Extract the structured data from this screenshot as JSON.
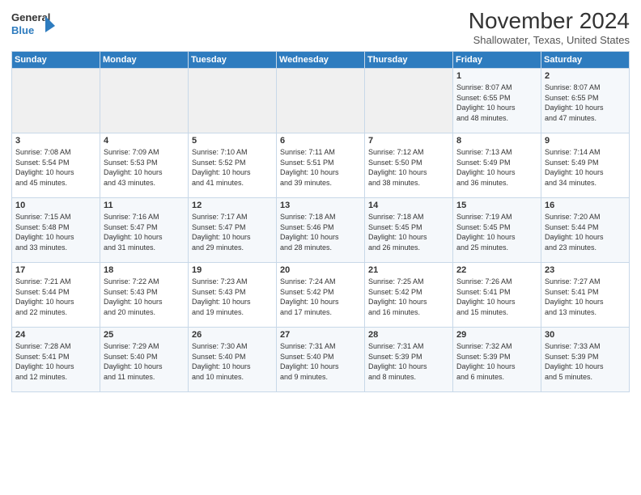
{
  "header": {
    "logo_line1": "General",
    "logo_line2": "Blue",
    "month": "November 2024",
    "location": "Shallowater, Texas, United States"
  },
  "weekdays": [
    "Sunday",
    "Monday",
    "Tuesday",
    "Wednesday",
    "Thursday",
    "Friday",
    "Saturday"
  ],
  "weeks": [
    [
      {
        "day": "",
        "info": ""
      },
      {
        "day": "",
        "info": ""
      },
      {
        "day": "",
        "info": ""
      },
      {
        "day": "",
        "info": ""
      },
      {
        "day": "",
        "info": ""
      },
      {
        "day": "1",
        "info": "Sunrise: 8:07 AM\nSunset: 6:55 PM\nDaylight: 10 hours\nand 48 minutes."
      },
      {
        "day": "2",
        "info": "Sunrise: 8:07 AM\nSunset: 6:55 PM\nDaylight: 10 hours\nand 47 minutes."
      }
    ],
    [
      {
        "day": "3",
        "info": "Sunrise: 7:08 AM\nSunset: 5:54 PM\nDaylight: 10 hours\nand 45 minutes."
      },
      {
        "day": "4",
        "info": "Sunrise: 7:09 AM\nSunset: 5:53 PM\nDaylight: 10 hours\nand 43 minutes."
      },
      {
        "day": "5",
        "info": "Sunrise: 7:10 AM\nSunset: 5:52 PM\nDaylight: 10 hours\nand 41 minutes."
      },
      {
        "day": "6",
        "info": "Sunrise: 7:11 AM\nSunset: 5:51 PM\nDaylight: 10 hours\nand 39 minutes."
      },
      {
        "day": "7",
        "info": "Sunrise: 7:12 AM\nSunset: 5:50 PM\nDaylight: 10 hours\nand 38 minutes."
      },
      {
        "day": "8",
        "info": "Sunrise: 7:13 AM\nSunset: 5:49 PM\nDaylight: 10 hours\nand 36 minutes."
      },
      {
        "day": "9",
        "info": "Sunrise: 7:14 AM\nSunset: 5:49 PM\nDaylight: 10 hours\nand 34 minutes."
      }
    ],
    [
      {
        "day": "10",
        "info": "Sunrise: 7:15 AM\nSunset: 5:48 PM\nDaylight: 10 hours\nand 33 minutes."
      },
      {
        "day": "11",
        "info": "Sunrise: 7:16 AM\nSunset: 5:47 PM\nDaylight: 10 hours\nand 31 minutes."
      },
      {
        "day": "12",
        "info": "Sunrise: 7:17 AM\nSunset: 5:47 PM\nDaylight: 10 hours\nand 29 minutes."
      },
      {
        "day": "13",
        "info": "Sunrise: 7:18 AM\nSunset: 5:46 PM\nDaylight: 10 hours\nand 28 minutes."
      },
      {
        "day": "14",
        "info": "Sunrise: 7:18 AM\nSunset: 5:45 PM\nDaylight: 10 hours\nand 26 minutes."
      },
      {
        "day": "15",
        "info": "Sunrise: 7:19 AM\nSunset: 5:45 PM\nDaylight: 10 hours\nand 25 minutes."
      },
      {
        "day": "16",
        "info": "Sunrise: 7:20 AM\nSunset: 5:44 PM\nDaylight: 10 hours\nand 23 minutes."
      }
    ],
    [
      {
        "day": "17",
        "info": "Sunrise: 7:21 AM\nSunset: 5:44 PM\nDaylight: 10 hours\nand 22 minutes."
      },
      {
        "day": "18",
        "info": "Sunrise: 7:22 AM\nSunset: 5:43 PM\nDaylight: 10 hours\nand 20 minutes."
      },
      {
        "day": "19",
        "info": "Sunrise: 7:23 AM\nSunset: 5:43 PM\nDaylight: 10 hours\nand 19 minutes."
      },
      {
        "day": "20",
        "info": "Sunrise: 7:24 AM\nSunset: 5:42 PM\nDaylight: 10 hours\nand 17 minutes."
      },
      {
        "day": "21",
        "info": "Sunrise: 7:25 AM\nSunset: 5:42 PM\nDaylight: 10 hours\nand 16 minutes."
      },
      {
        "day": "22",
        "info": "Sunrise: 7:26 AM\nSunset: 5:41 PM\nDaylight: 10 hours\nand 15 minutes."
      },
      {
        "day": "23",
        "info": "Sunrise: 7:27 AM\nSunset: 5:41 PM\nDaylight: 10 hours\nand 13 minutes."
      }
    ],
    [
      {
        "day": "24",
        "info": "Sunrise: 7:28 AM\nSunset: 5:41 PM\nDaylight: 10 hours\nand 12 minutes."
      },
      {
        "day": "25",
        "info": "Sunrise: 7:29 AM\nSunset: 5:40 PM\nDaylight: 10 hours\nand 11 minutes."
      },
      {
        "day": "26",
        "info": "Sunrise: 7:30 AM\nSunset: 5:40 PM\nDaylight: 10 hours\nand 10 minutes."
      },
      {
        "day": "27",
        "info": "Sunrise: 7:31 AM\nSunset: 5:40 PM\nDaylight: 10 hours\nand 9 minutes."
      },
      {
        "day": "28",
        "info": "Sunrise: 7:31 AM\nSunset: 5:39 PM\nDaylight: 10 hours\nand 8 minutes."
      },
      {
        "day": "29",
        "info": "Sunrise: 7:32 AM\nSunset: 5:39 PM\nDaylight: 10 hours\nand 6 minutes."
      },
      {
        "day": "30",
        "info": "Sunrise: 7:33 AM\nSunset: 5:39 PM\nDaylight: 10 hours\nand 5 minutes."
      }
    ]
  ]
}
